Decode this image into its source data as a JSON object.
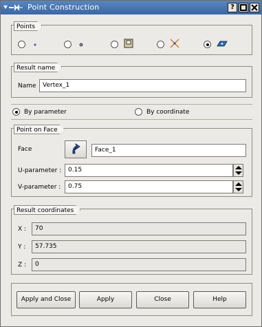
{
  "window": {
    "title": "Point Construction",
    "buttons": {
      "help": "?",
      "maximize": "□",
      "close": "✕"
    }
  },
  "points_group": {
    "title": "Points",
    "options": [
      {
        "icon": "point-xyz-icon",
        "selected": false
      },
      {
        "icon": "point-reference-icon",
        "selected": false
      },
      {
        "icon": "point-on-edge-icon",
        "selected": false
      },
      {
        "icon": "point-intersection-icon",
        "selected": false
      },
      {
        "icon": "point-on-face-icon",
        "selected": true
      }
    ]
  },
  "result_name": {
    "title": "Result name",
    "label": "Name",
    "value": "Vertex_1"
  },
  "mode": {
    "by_parameter": "By parameter",
    "by_coordinate": "By coordinate",
    "selected": "by_parameter"
  },
  "point_on_face": {
    "title": "Point on Face",
    "face_label": "Face",
    "face_value": "Face_1",
    "u_label": "U-parameter :",
    "u_value": "0.15",
    "v_label": "V-parameter :",
    "v_value": "0.75"
  },
  "result_coordinates": {
    "title": "Result coordinates",
    "x_label": "X :",
    "x_value": "70",
    "y_label": "Y :",
    "y_value": "57.735",
    "z_label": "Z :",
    "z_value": "0"
  },
  "actions": {
    "apply_close": "Apply and Close",
    "apply": "Apply",
    "close": "Close",
    "help": "Help"
  }
}
